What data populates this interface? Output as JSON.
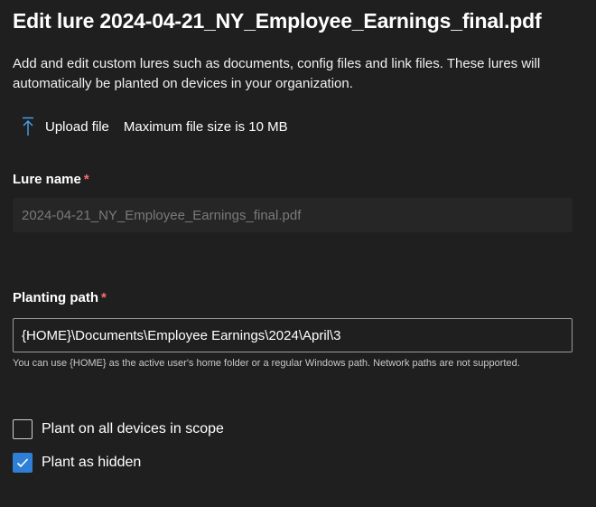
{
  "panel": {
    "title": "Edit lure 2024-04-21_NY_Employee_Earnings_final.pdf",
    "description": "Add and edit custom lures such as documents, config files and link files. These lures will automatically be planted on devices in your organization."
  },
  "upload": {
    "icon": "upload-icon",
    "label": "Upload file",
    "hint": "Maximum file size is 10 MB"
  },
  "lure_name": {
    "label": "Lure name",
    "required_marker": "*",
    "value": "2024-04-21_NY_Employee_Earnings_final.pdf",
    "disabled": true
  },
  "planting_path": {
    "label": "Planting path",
    "required_marker": "*",
    "value": "{HOME}\\Documents\\Employee Earnings\\2024\\April\\3",
    "helper": "You can use {HOME} as the active user's home folder or a regular Windows path. Network paths are not supported."
  },
  "options": {
    "plant_all": {
      "label": "Plant on all devices in scope",
      "checked": false
    },
    "plant_hidden": {
      "label": "Plant as hidden",
      "checked": true
    }
  },
  "colors": {
    "background": "#1f1f1f",
    "accent": "#2f7fd6",
    "required": "#ff6b6b",
    "disabled_text": "#7a7a7a"
  }
}
